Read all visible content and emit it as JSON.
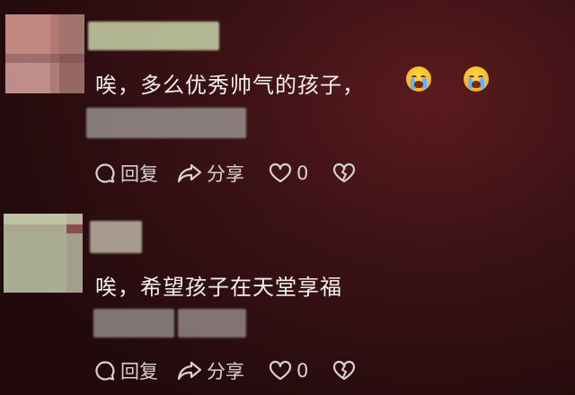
{
  "comments": [
    {
      "text": "唉，多么优秀帅气的孩子，",
      "emojis": [
        "loudly-crying-face",
        "loudly-crying-face"
      ],
      "actions": {
        "reply_label": "回复",
        "share_label": "分享",
        "like_count": "0"
      }
    },
    {
      "text": "唉，希望孩子在天堂享福",
      "emojis": [],
      "actions": {
        "reply_label": "回复",
        "share_label": "分享",
        "like_count": "0"
      }
    }
  ],
  "colors": {
    "background_center": "#5a1a1f",
    "background_edge": "#220a0c",
    "text": "#f4efef",
    "action_text": "#d8d2d2"
  }
}
